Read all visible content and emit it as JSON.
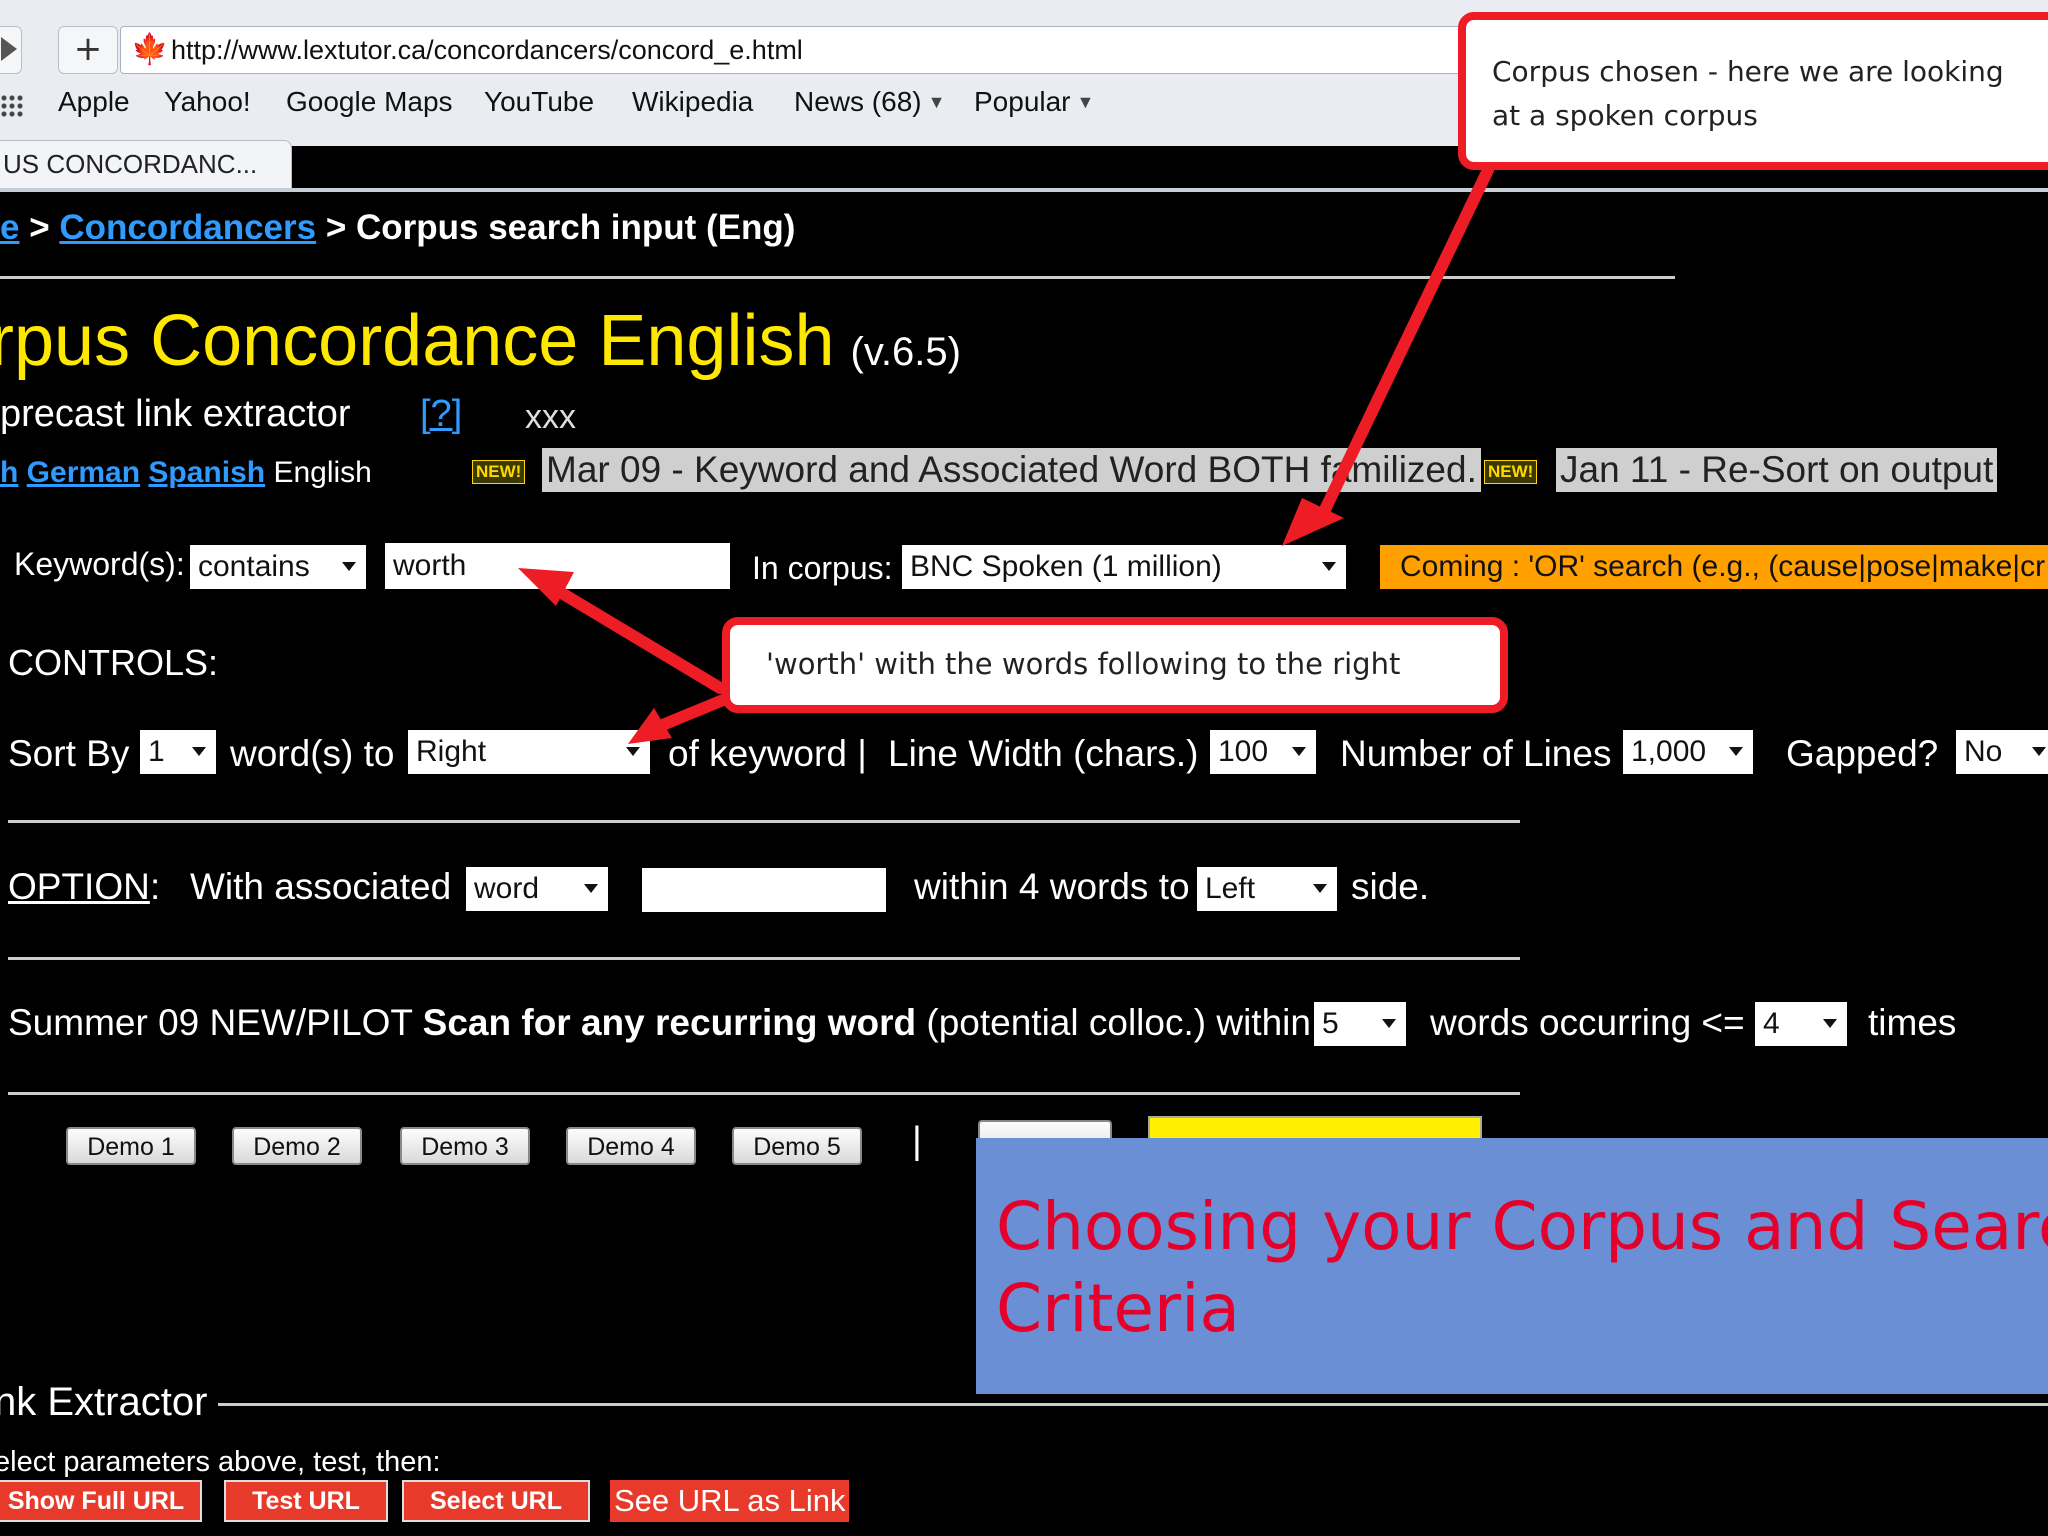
{
  "browser": {
    "newtab_symbol": "+",
    "url": "http://www.lextutor.ca/concordancers/concord_e.html",
    "bookmarks": [
      "Apple",
      "Yahoo!",
      "Google Maps",
      "YouTube",
      "Wikipedia",
      "News (68)",
      "Popular"
    ],
    "tab_title": "US CONCORDANC..."
  },
  "page": {
    "breadcrumb": {
      "home_fragment": "e",
      "sep1": " > ",
      "concordancers": "Concordancers",
      "current": " > Corpus search input (Eng)"
    },
    "title": "rpus Concordance English",
    "version": "(v.6.5)",
    "subtitle": "precast link extractor",
    "help_link": "[?]",
    "xxx": "xxx",
    "languages": {
      "fragment": "h",
      "german": "German",
      "spanish": "Spanish",
      "current": "English"
    },
    "new_badge": "NEW!",
    "news1": "Mar 09 - Keyword and Associated Word BOTH familized.",
    "news2": "Jan 11 - Re-Sort on output"
  },
  "search": {
    "keyword_label": "Keyword(s):",
    "keyword_mode": "contains",
    "keyword_value": "worth",
    "corpus_label": "In corpus:",
    "corpus_value": "BNC Spoken (1 million)",
    "coming_banner": "Coming : 'OR' search (e.g., (cause|pose|make|cr"
  },
  "controls": {
    "label": "CONTROLS:",
    "sort_by": "Sort By",
    "sort_num": "1",
    "words_to": "word(s) to",
    "sort_direction": "Right",
    "of_keyword": "of keyword  |",
    "line_width_label": "Line Width (chars.)",
    "line_width": "100",
    "num_lines_label": "Number of Lines",
    "num_lines": "1,000",
    "gapped_label": "Gapped?",
    "gapped": "No"
  },
  "option": {
    "label": "OPTION",
    "colon": ":",
    "with_assoc": "With associated",
    "assoc_type": "word",
    "assoc_value": "",
    "within": "within 4 words to",
    "side_value": "Left",
    "side_label": "side."
  },
  "scan": {
    "prefix": "Summer 09 NEW/PILOT ",
    "bold": "Scan for any recurring word",
    "suffix": " (potential colloc.) within",
    "within_value": "5",
    "occurring_label": "words occurring <=",
    "times_value": "4",
    "times_label": "times"
  },
  "demos": [
    "Demo 1",
    "Demo 2",
    "Demo 3",
    "Demo 4",
    "Demo 5"
  ],
  "pipe": "|",
  "extractor": {
    "legend": "nk Extractor",
    "instructions": "elect parameters above, test, then:",
    "btn_full": "Show Full URL",
    "btn_test": "Test URL",
    "btn_select": "Select URL",
    "see_link": "See URL as Link"
  },
  "annotations": {
    "corpus_callout": [
      "Corpus chosen - here we are looking",
      "at a spoken corpus"
    ],
    "worth_callout": "'worth' with the words following to the right",
    "title_overlay": [
      "Choosing your Corpus and Search",
      "Criteria"
    ],
    "arrow_color": "#ee1c24",
    "overlay_color": "#6b8fd4"
  }
}
